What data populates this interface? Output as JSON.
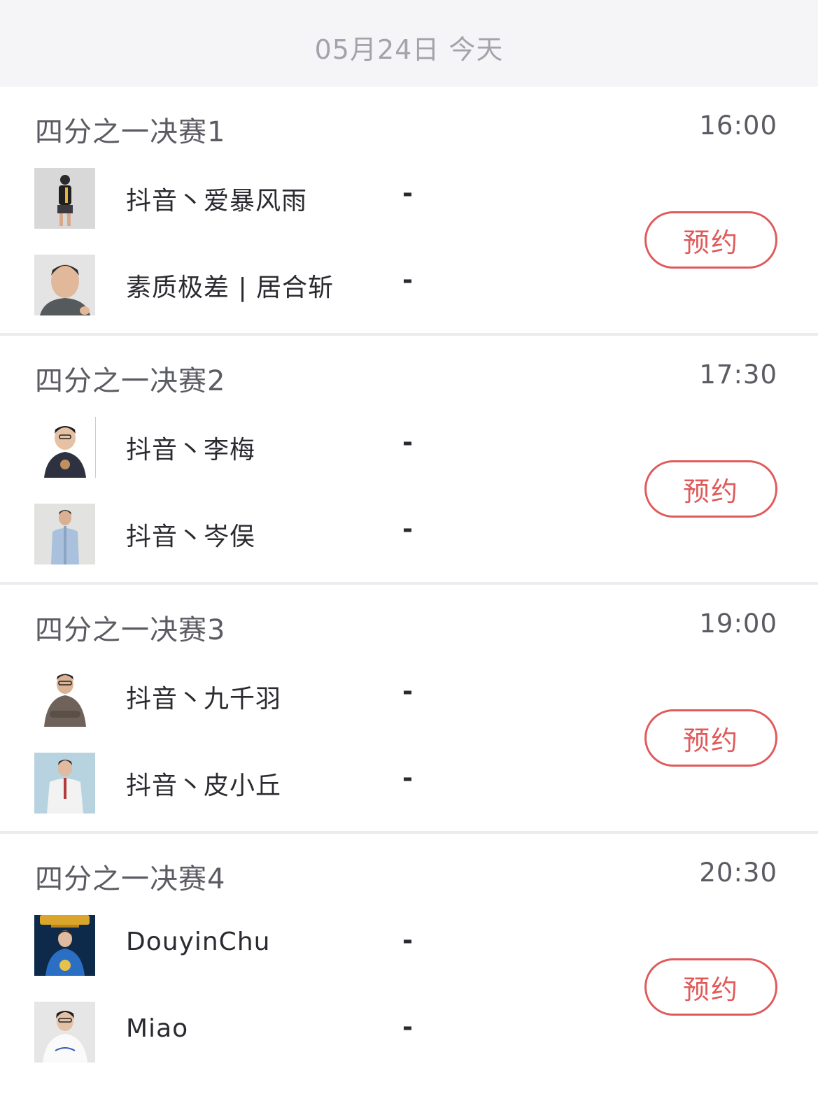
{
  "date_header": "05月24日 今天",
  "colors": {
    "accent": "#e05a5a",
    "title_text": "#5b5b63",
    "name_text": "#2a2a30",
    "background": "#f5f5f8"
  },
  "matches": [
    {
      "title": "四分之一决赛1",
      "time": "16:00",
      "reserve_label": "预约",
      "players": [
        {
          "name": "抖音丶爱暴风雨",
          "score": "-",
          "avatar": "person-avatar-icon"
        },
        {
          "name": "素质极差 | 居合斩",
          "score": "-",
          "avatar": "person-avatar-icon"
        }
      ]
    },
    {
      "title": "四分之一决赛2",
      "time": "17:30",
      "reserve_label": "预约",
      "players": [
        {
          "name": "抖音丶李梅",
          "score": "-",
          "avatar": "person-avatar-icon"
        },
        {
          "name": "抖音丶岑俣",
          "score": "-",
          "avatar": "person-avatar-icon"
        }
      ]
    },
    {
      "title": "四分之一决赛3",
      "time": "19:00",
      "reserve_label": "预约",
      "players": [
        {
          "name": "抖音丶九千羽",
          "score": "-",
          "avatar": "person-avatar-icon"
        },
        {
          "name": "抖音丶皮小丘",
          "score": "-",
          "avatar": "person-avatar-icon"
        }
      ]
    },
    {
      "title": "四分之一决赛4",
      "time": "20:30",
      "reserve_label": "预约",
      "players": [
        {
          "name": "DouyinChu",
          "score": "-",
          "avatar": "person-avatar-icon"
        },
        {
          "name": "Miao",
          "score": "-",
          "avatar": "person-avatar-icon"
        }
      ]
    }
  ]
}
